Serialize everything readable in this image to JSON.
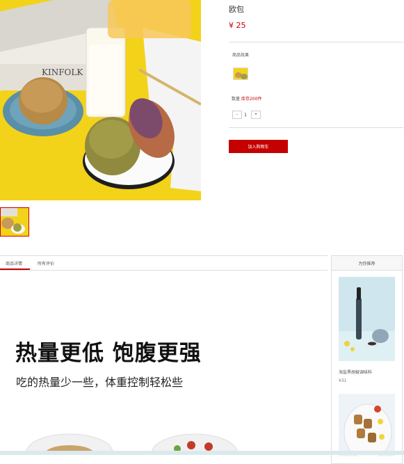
{
  "product": {
    "title": "欧包",
    "price": "¥ 25",
    "effect_label": "商品效果",
    "quantity_label": "数量",
    "stock_text": "库存200件",
    "quantity_value": "1",
    "minus": "-",
    "plus": "+",
    "add_to_cart": "加入购物车"
  },
  "tabs": [
    {
      "label": "商品详情",
      "active": true
    },
    {
      "label": "所有评价",
      "active": false
    }
  ],
  "recommend": {
    "title": "为你推荐",
    "items": [
      {
        "name": "海盐黑胡椒调味料",
        "price": "¥31"
      }
    ]
  },
  "detail": {
    "headline": "热量更低 饱腹更强",
    "subline": "吃的热量少一些，体重控制轻松些"
  },
  "colors": {
    "accent": "#c40000",
    "hero_bg": "#f3d21a"
  }
}
